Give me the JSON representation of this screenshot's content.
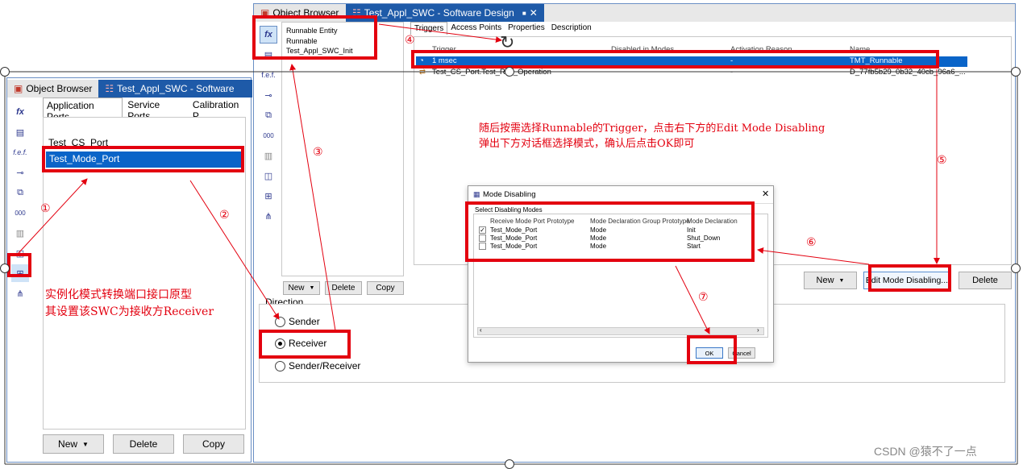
{
  "left_window": {
    "tabs": [
      {
        "label": "Object Browser"
      },
      {
        "label": "Test_Appl_SWC - Software"
      }
    ],
    "subtabs": [
      "Application Ports",
      "Service Ports",
      "Calibration P"
    ],
    "list": [
      "Test_CS_Port",
      "Test_Mode_Port"
    ],
    "buttons": {
      "new": "New",
      "delete": "Delete",
      "copy": "Copy"
    },
    "icons": [
      "fx",
      "grid",
      "f.e.f.",
      "port",
      "ports",
      "000",
      "module",
      "app",
      "selected-port",
      "network"
    ]
  },
  "main_window": {
    "tabs": [
      {
        "label": "Object Browser"
      },
      {
        "label": "Test_Appl_SWC - Software Design"
      }
    ],
    "runnable_panel": {
      "header": "Runnable Entity",
      "items": [
        "Runnable",
        "Test_Appl_SWC_Init"
      ],
      "buttons": {
        "new": "New",
        "delete": "Delete",
        "copy": "Copy"
      }
    },
    "subtabs": [
      "Triggers",
      "Access Points",
      "Properties",
      "Description"
    ],
    "table": {
      "columns": [
        "Trigger",
        "Disabled in Modes",
        "Activation Reason",
        "Name"
      ],
      "rows": [
        {
          "trigger": "1 msec",
          "disabled": "",
          "reason": "-",
          "name": "TMT_Runnable"
        },
        {
          "trigger": "Test_CS_Port.Test_Res_Operation",
          "disabled": "",
          "reason": "-",
          "name": "D_77fb5b29_0b32_40cb_96a6_..."
        }
      ]
    },
    "buttons": {
      "new": "New",
      "edit": "Edit Mode Disabling...",
      "delete": "Delete"
    },
    "direction": {
      "label": "Direction",
      "options": [
        "Sender",
        "Receiver",
        "Sender/Receiver"
      ],
      "selected": 1
    }
  },
  "dialog": {
    "title": "Mode Disabling",
    "section": "Select Disabling Modes",
    "columns": [
      "Receive Mode Port Prototype",
      "Mode Declaration Group Prototype",
      "Mode Declaration"
    ],
    "rows": [
      {
        "checked": true,
        "port": "Test_Mode_Port",
        "group": "Mode",
        "decl": "Init"
      },
      {
        "checked": false,
        "port": "Test_Mode_Port",
        "group": "Mode",
        "decl": "Shut_Down"
      },
      {
        "checked": false,
        "port": "Test_Mode_Port",
        "group": "Mode",
        "decl": "Start"
      }
    ],
    "ok": "OK",
    "cancel": "Cancel"
  },
  "annotations": {
    "note_left_1": "实例化模式转换端口接口原型",
    "note_left_2": "其设置该SWC为接收方Receiver",
    "note_right_1": "随后按需选择Runnable的Trigger，点击右下方的Edit Mode Disabling",
    "note_right_2": "弹出下方对话框选择模式，确认后点击OK即可",
    "steps": [
      "①",
      "②",
      "③",
      "④",
      "⑤",
      "⑥",
      "⑦"
    ]
  },
  "watermark": "CSDN @猿不了一点",
  "colors": {
    "accent": "#1e5aa8",
    "highlight": "#0a64c8",
    "annotation": "#e3000f"
  }
}
